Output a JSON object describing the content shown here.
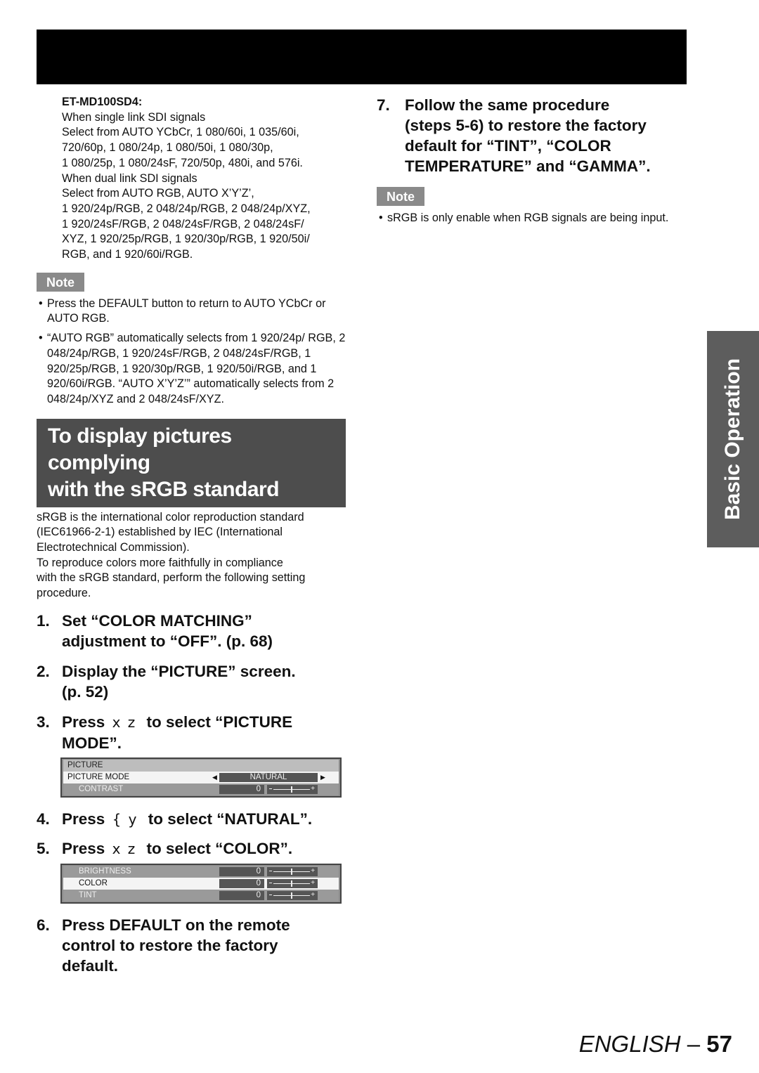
{
  "header": {
    "title": ""
  },
  "left": {
    "model_label": "ET-MD100SD4:",
    "model_lines": [
      "When single link SDI signals",
      "Select from AUTO YCbCr, 1 080/60i, 1 035/60i,",
      "720/60p, 1 080/24p, 1 080/50i, 1 080/30p,",
      "1 080/25p, 1 080/24sF, 720/50p, 480i, and 576i.",
      "When dual link SDI signals",
      "Select from AUTO RGB, AUTO X’Y’Z’,",
      "1 920/24p/RGB, 2 048/24p/RGB, 2 048/24p/XYZ,",
      "1 920/24sF/RGB, 2 048/24sF/RGB, 2 048/24sF/",
      "XYZ, 1 920/25p/RGB, 1 920/30p/RGB, 1 920/50i/",
      "RGB, and 1 920/60i/RGB."
    ],
    "note_label": "Note",
    "notes": [
      "Press the DEFAULT button to return to AUTO YCbCr or AUTO RGB.",
      "“AUTO RGB” automatically selects from 1 920/24p/ RGB, 2 048/24p/RGB, 1 920/24sF/RGB, 2 048/24sF/RGB, 1 920/25p/RGB, 1 920/30p/RGB, 1 920/50i/RGB, and 1 920/60i/RGB. “AUTO X’Y’Z’” automatically selects from 2 048/24p/XYZ and 2 048/24sF/XYZ."
    ],
    "section_title_line1": "To display pictures complying",
    "section_title_line2": "with the sRGB standard",
    "intro_lines": [
      "sRGB is the international color reproduction standard",
      "(IEC61966-2-1) established by IEC (International",
      "Electrotechnical Commission).",
      "To reproduce colors more faithfully in compliance",
      "with the sRGB standard, perform the following setting",
      "procedure."
    ],
    "steps": [
      {
        "num": "1.",
        "line1": "Set “COLOR MATCHING”",
        "line2": "adjustment to “OFF”. (p. 68)"
      },
      {
        "num": "2.",
        "line1": "Display the “PICTURE” screen.",
        "line2": "(p. 52)"
      },
      {
        "num": "3.",
        "pre": "Press",
        "keys": "x z",
        "post": "to select “PICTURE",
        "line2": "MODE”."
      },
      {
        "num": "4.",
        "pre": "Press",
        "keys": "{ y",
        "post": "to select “NATURAL”."
      },
      {
        "num": "5.",
        "pre": "Press",
        "keys": "x z",
        "post": "to select  “COLOR”."
      },
      {
        "num": "6.",
        "line1": "Press DEFAULT on the remote",
        "line2": "control to restore the factory",
        "line3": "default."
      }
    ],
    "menu1": {
      "title": "PICTURE",
      "rows": [
        {
          "label": "PICTURE MODE",
          "value": "NATURAL"
        },
        {
          "label": "CONTRAST",
          "value": "0",
          "slider": 0.5
        }
      ]
    },
    "menu2": {
      "rows": [
        {
          "label": "BRIGHTNESS",
          "value": "0",
          "slider": 0.5
        },
        {
          "label": "COLOR",
          "value": "0",
          "slider": 0.5
        },
        {
          "label": "TINT",
          "value": "0",
          "slider": 0.5
        }
      ]
    }
  },
  "right": {
    "step7": {
      "num": "7.",
      "lines": [
        "Follow the same procedure",
        "(steps 5-6) to restore the factory",
        "default for “TINT”, “COLOR",
        "TEMPERATURE” and “GAMMA”."
      ]
    },
    "note_label": "Note",
    "notes": [
      "sRGB is only enable when RGB signals are being input."
    ]
  },
  "side_tab": {
    "label": "Basic Operation"
  },
  "footer": {
    "language": "ENGLISH",
    "separator": " – ",
    "page": "57"
  },
  "colors": {
    "header_bar": "#000000",
    "section_head": "#4d4d4d",
    "note_label": "#8a8a8a",
    "side_tab": "#5d5d5d"
  }
}
